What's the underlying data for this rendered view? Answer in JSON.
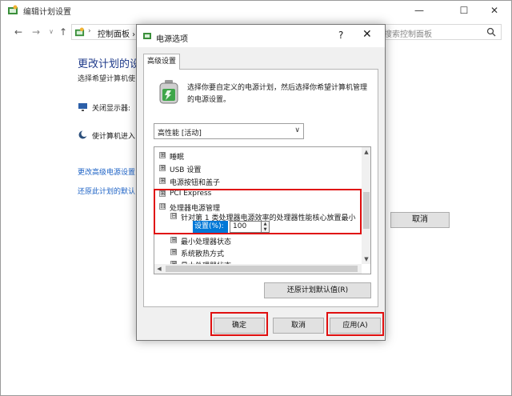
{
  "window": {
    "title": "编辑计划设置",
    "minimize": "—",
    "maximize": "☐",
    "close": "✕"
  },
  "nav": {
    "back": "←",
    "forward": "→",
    "recent": "∨",
    "up": "↑",
    "breadcrumb": "控制面板 › 所有控制面板项 › 电源选项 › 编辑计划设置",
    "chevron": "›"
  },
  "search": {
    "placeholder": "搜索控制面板"
  },
  "background": {
    "heading": "更改计划的设置",
    "subtitle": "选择希望计算机使",
    "display_label": "关闭显示器:",
    "sleep_label": "使计算机进入",
    "link_advanced": "更改高级电源设置",
    "link_restore": "还原此计划的默认",
    "cancel_label": "取消"
  },
  "dialog": {
    "title": "电源选项",
    "help": "?",
    "close": "✕",
    "tab": "高级设置",
    "description": "选择你要自定义的电源计划，然后选择你希望计算机管理的电源设置。",
    "plan_selected": "高性能 [活动]",
    "plan_arrow": "∨",
    "tree": [
      {
        "toggle": "⊞",
        "label": "睡眠"
      },
      {
        "toggle": "⊞",
        "label": "USB 设置"
      },
      {
        "toggle": "⊞",
        "label": "电源按钮和盖子"
      },
      {
        "toggle": "⊞",
        "label": "PCI Express"
      },
      {
        "toggle": "⊟",
        "label": "处理器电源管理"
      },
      {
        "toggle": "⊟",
        "label": "针对第 1 类处理器电源效率的处理器性能核心放置最小"
      },
      {
        "toggle": "⊞",
        "label": "最小处理器状态"
      },
      {
        "toggle": "⊞",
        "label": "系统散热方式"
      },
      {
        "toggle": "⊞",
        "label": "最大处理器状态"
      }
    ],
    "setting_label": "设置(%):",
    "setting_value": "100",
    "spin_up": "▲",
    "spin_down": "▼",
    "scroll_up": "▲",
    "scroll_down": "▼",
    "scroll_left": "◀",
    "restore_label": "还原计划默认值(R)",
    "ok_label": "确定",
    "cancel_label": "取消",
    "apply_label": "应用(A)"
  },
  "colors": {
    "highlight": "#0078d7",
    "annotation": "#e01010",
    "link": "#1e63c6"
  }
}
